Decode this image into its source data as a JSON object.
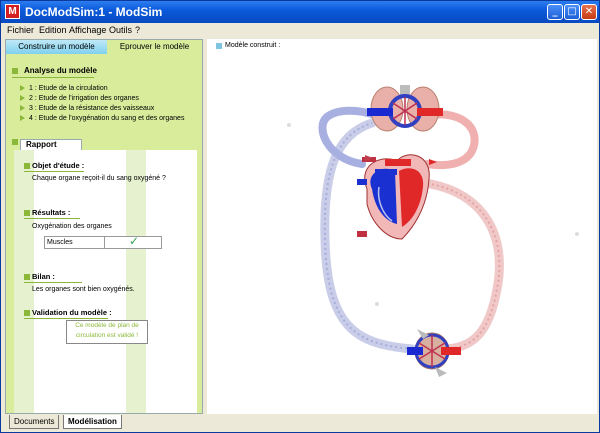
{
  "window": {
    "title": "DocModSim:1 - ModSim",
    "icon_letter": "M"
  },
  "menu": [
    "Fichier",
    "Edition",
    "Affichage",
    "Outils",
    "?"
  ],
  "tabs": {
    "build": "Construire un modèle",
    "test": "Eprouver le modèle"
  },
  "analyse": {
    "heading": "Analyse du modèle",
    "items": [
      "1 : Etude de la circulation",
      "2 : Etude de l'irrigation des organes",
      "3 : Etude de la résistance des vaisseaux",
      "4 : Etude de l'oxygénation du sang et des organes"
    ]
  },
  "rapport": {
    "tab": "Rapport",
    "objet_heading": "Objet d'étude :",
    "objet_text": "Chaque organe reçoit-il du sang oxygéné ?",
    "resultats_heading": "Résultats :",
    "resultats_sub": "Oxygénation des organes",
    "table": {
      "label": "Muscles",
      "check": "✓"
    },
    "bilan_heading": "Bilan :",
    "bilan_text": "Les organes sont bien oxygénés.",
    "validation_heading": "Validation du modèle :",
    "validation_text_1": "Ce modèle de plan de",
    "validation_text_2": "circulation est validé !"
  },
  "right": {
    "title": "Modèle construit :"
  },
  "bottom_tabs": {
    "documents": "Documents",
    "modelisation": "Modélisation"
  },
  "colors": {
    "oxygenated": "#e04040",
    "deoxygenated": "#2040d0",
    "accent_green": "#8cb83a"
  }
}
